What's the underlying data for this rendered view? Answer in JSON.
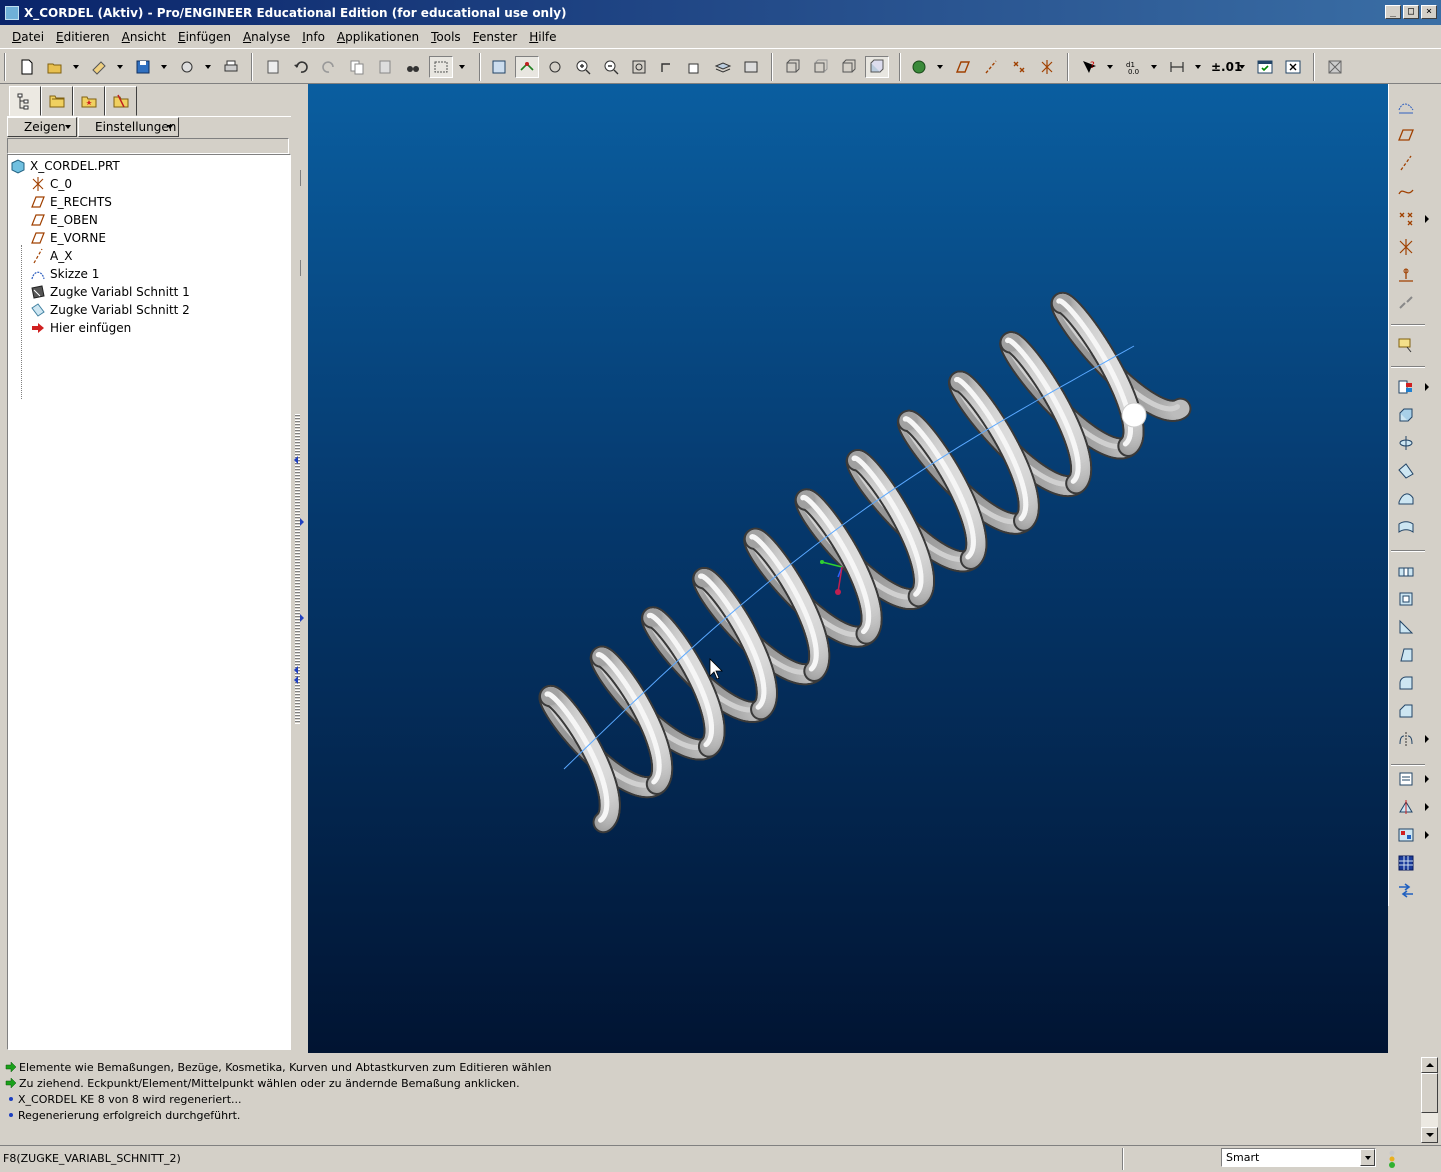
{
  "window": {
    "title": "X_CORDEL (Aktiv) - Pro/ENGINEER Educational Edition (for educational use only)",
    "controls": [
      "_",
      "□",
      "×"
    ]
  },
  "menu": [
    "Datei",
    "Editieren",
    "Ansicht",
    "Einfügen",
    "Analyse",
    "Info",
    "Applikationen",
    "Tools",
    "Fenster",
    "Hilfe"
  ],
  "toolbar": {
    "tolerance_label": "±.01"
  },
  "model_tree": {
    "show_label": "Zeigen",
    "settings_label": "Einstellungen",
    "root": "X_CORDEL.PRT",
    "items": [
      {
        "label": "C_0",
        "icon": "csys-icon"
      },
      {
        "label": "E_RECHTS",
        "icon": "datum-plane-icon"
      },
      {
        "label": "E_OBEN",
        "icon": "datum-plane-icon"
      },
      {
        "label": "E_VORNE",
        "icon": "datum-plane-icon"
      },
      {
        "label": "A_X",
        "icon": "datum-axis-icon"
      },
      {
        "label": "Skizze 1",
        "icon": "sketch-icon"
      },
      {
        "label": "Zugke Variabl Schnitt 1",
        "icon": "variable-sweep-icon"
      },
      {
        "label": "Zugke Variabl Schnitt 2",
        "icon": "variable-sweep-icon"
      },
      {
        "label": "Hier einfügen",
        "icon": "insert-here-arrow-icon"
      }
    ]
  },
  "messages": [
    {
      "type": "prompt",
      "text": "Elemente wie Bemaßungen, Bezüge, Kosmetika, Kurven und Abtastkurven zum Editieren wählen"
    },
    {
      "type": "prompt",
      "text": "Zu ziehend. Eckpunkt/Element/Mittelpunkt wählen oder zu ändernde Bemaßung anklicken."
    },
    {
      "type": "info",
      "text": "X_CORDEL KE 8 von 8 wird regeneriert..."
    },
    {
      "type": "info",
      "text": "Regenerierung erfolgreich durchgeführt."
    }
  ],
  "status": {
    "selected_feature": "F8(ZUGKE_VARIABL_SCHNITT_2)",
    "filter": "Smart"
  },
  "colors": {
    "viewport_top": "#0a5ea0",
    "viewport_bottom": "#011432",
    "title_bar": "#0a246a",
    "spring": "#d8d8d8",
    "prompt_arrow": "#1aa01a"
  }
}
